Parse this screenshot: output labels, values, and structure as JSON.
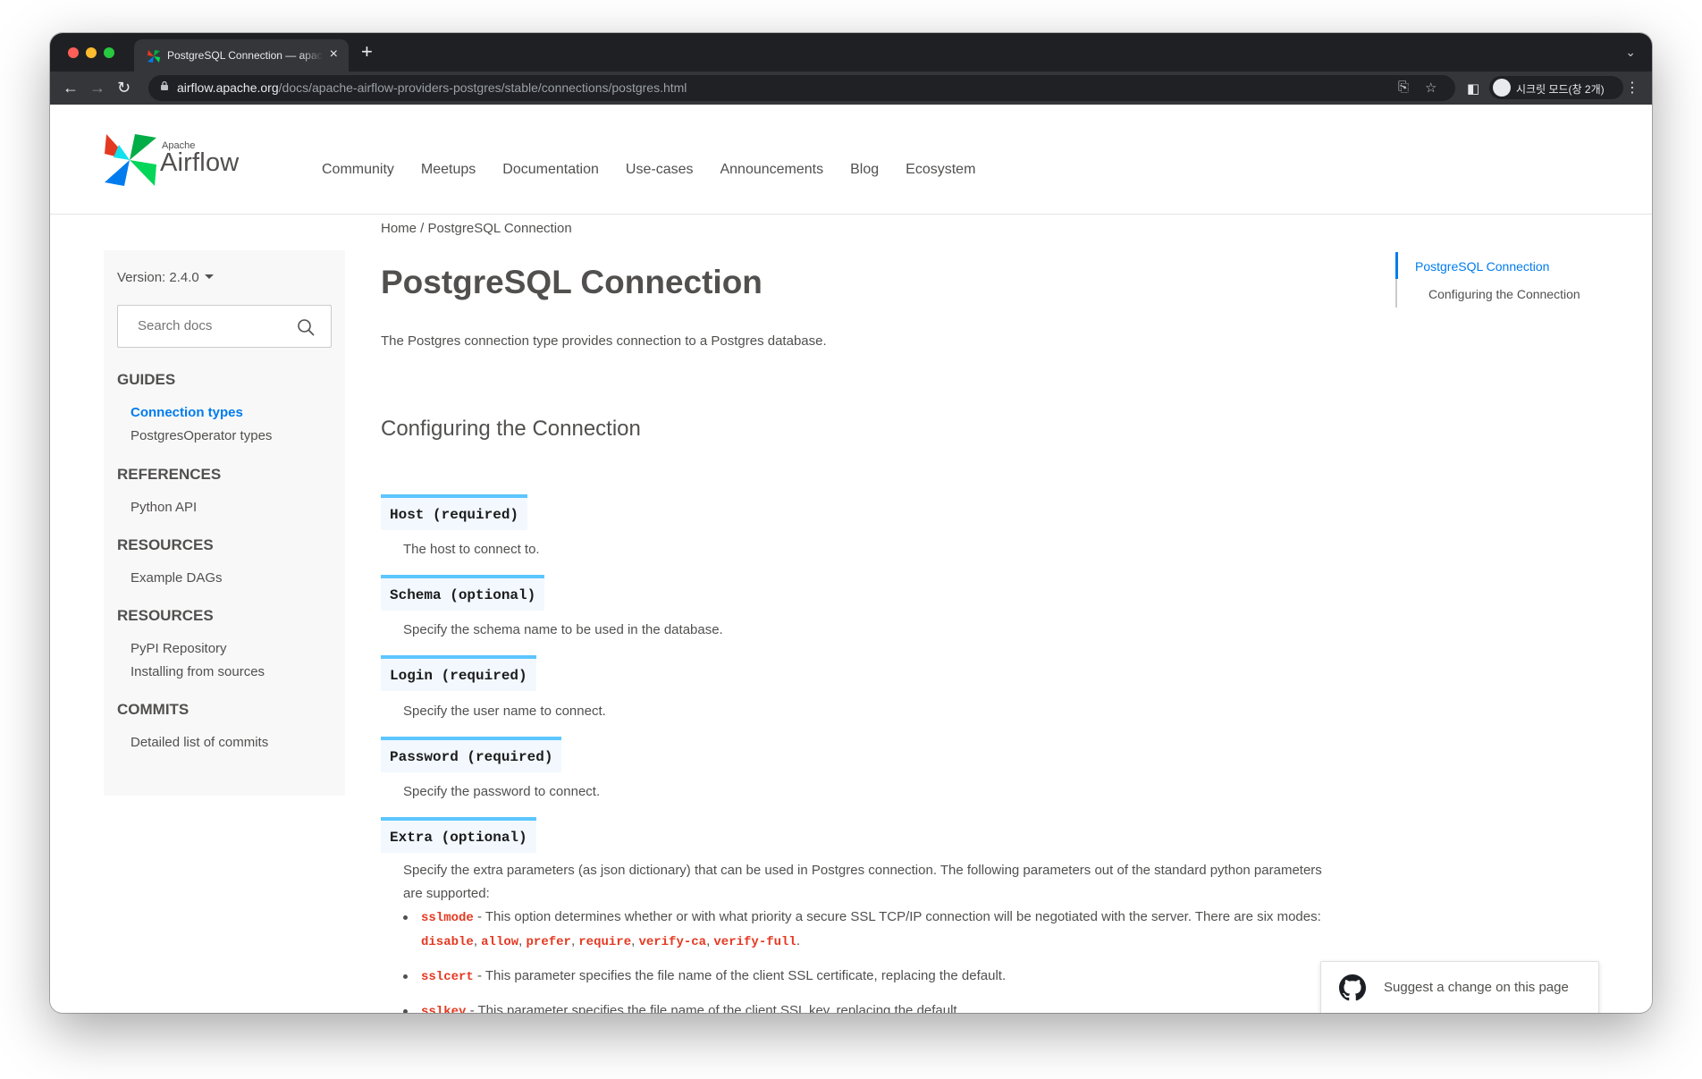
{
  "browser": {
    "tab_title": "PostgreSQL Connection — apache-airflow-providers-postgres",
    "new_tab": "+",
    "url_host": "airflow.apache.org",
    "url_path": "/docs/apache-airflow-providers-postgres/stable/connections/postgres.html",
    "incognito_label": "시크릿 모드(창 2개)"
  },
  "site": {
    "logo_small": "Apache",
    "logo_big": "Airflow",
    "nav": [
      "Community",
      "Meetups",
      "Documentation",
      "Use-cases",
      "Announcements",
      "Blog",
      "Ecosystem"
    ]
  },
  "breadcrumb": "Home / PostgreSQL Connection",
  "sidebar": {
    "version": "Version: 2.4.0",
    "search_placeholder": "Search docs",
    "sections": [
      {
        "title": "GUIDES",
        "items": [
          "Connection types",
          "PostgresOperator types"
        ]
      },
      {
        "title": "REFERENCES",
        "items": [
          "Python API"
        ]
      },
      {
        "title": "RESOURCES",
        "items": [
          "Example DAGs"
        ]
      },
      {
        "title": "RESOURCES",
        "items": [
          "PyPI Repository",
          "Installing from sources"
        ]
      },
      {
        "title": "COMMITS",
        "items": [
          "Detailed list of commits"
        ]
      }
    ]
  },
  "main": {
    "title": "PostgreSQL Connection",
    "intro": "The Postgres connection type provides connection to a Postgres database.",
    "section_title": "Configuring the Connection",
    "fields": [
      {
        "term": "Host (required)",
        "desc": "The host to connect to."
      },
      {
        "term": "Schema (optional)",
        "desc": "Specify the schema name to be used in the database."
      },
      {
        "term": "Login (required)",
        "desc": "Specify the user name to connect."
      },
      {
        "term": "Password (required)",
        "desc": "Specify the password to connect."
      },
      {
        "term": "Extra (optional)",
        "desc": "Specify the extra parameters (as json dictionary) that can be used in Postgres connection. The following parameters out of the standard python parameters are supported:"
      }
    ],
    "bullets": [
      {
        "key": "sslmode",
        "text": " - This option determines whether or with what priority a secure SSL TCP/IP connection will be negotiated with the server. There are six modes: ",
        "modes": [
          "disable",
          "allow",
          "prefer",
          "require",
          "verify-ca",
          "verify-full"
        ]
      },
      {
        "key": "sslcert",
        "text": " - This parameter specifies the file name of the client SSL certificate, replacing the default."
      },
      {
        "key": "sslkey",
        "text": " - This parameter specifies the file name of the client SSL key, replacing the default."
      }
    ]
  },
  "toc": [
    "PostgreSQL Connection",
    "Configuring the Connection"
  ],
  "suggest_label": "Suggest a change on this page",
  "colors": {
    "accent": "#017cee",
    "field_border": "#5cc6ff",
    "code_red": "#e43921"
  }
}
